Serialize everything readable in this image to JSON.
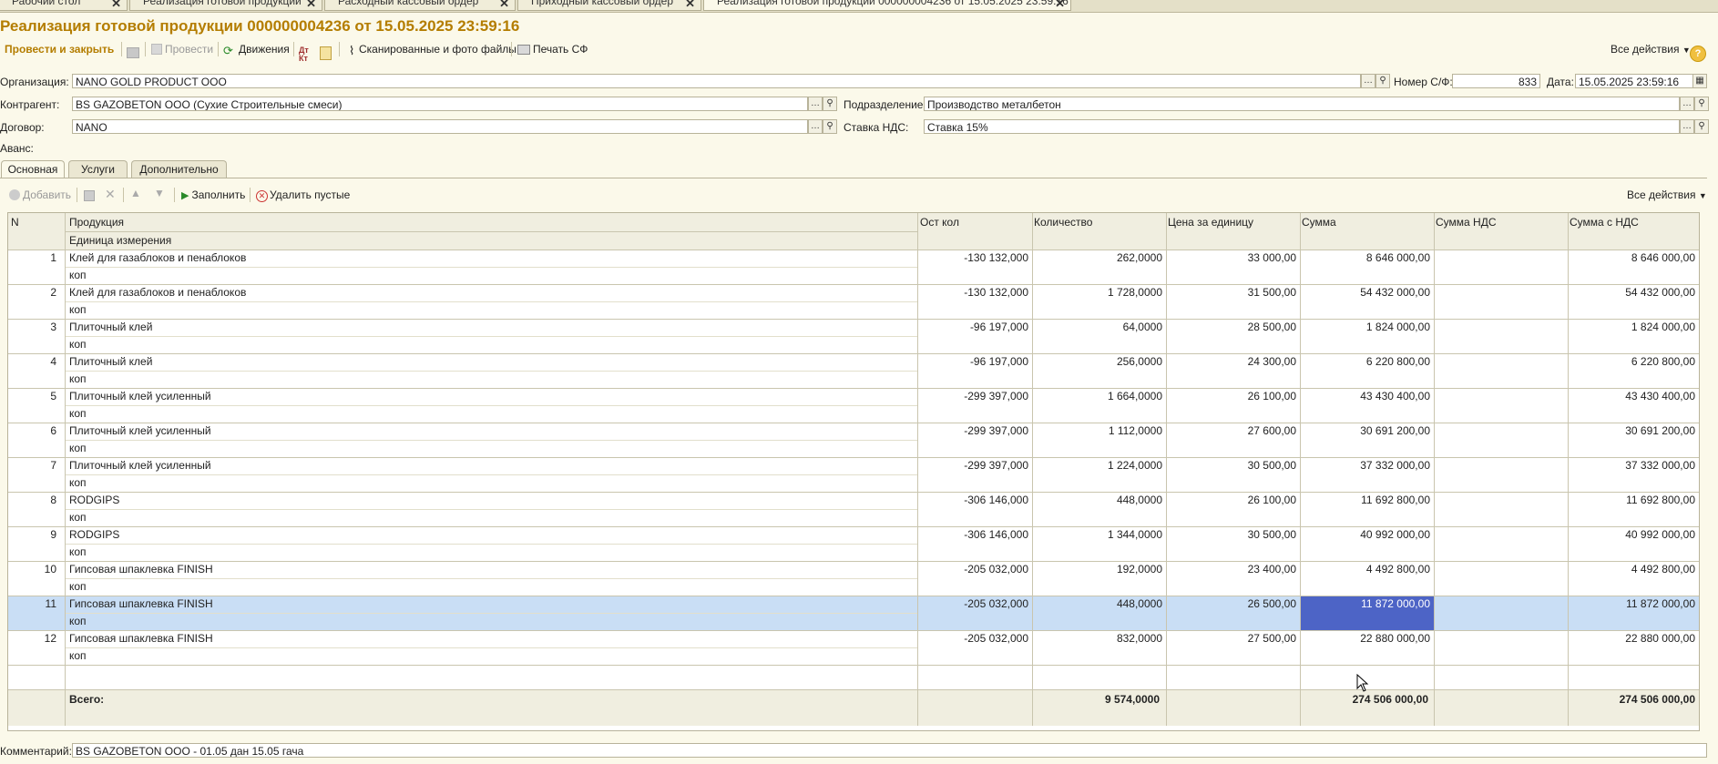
{
  "window_tabs": [
    {
      "label": "Рабочий стол",
      "active": false
    },
    {
      "label": "Реализация готовой продукции",
      "active": false
    },
    {
      "label": "Расходный кассовый ордер",
      "active": false
    },
    {
      "label": "Приходный кассовый ордер",
      "active": false
    },
    {
      "label": "Реализация готовой продукции 000000004236 от 15.05.2025 23:59:16",
      "active": true
    }
  ],
  "doc_title": "Реализация готовой продукции 000000004236 от 15.05.2025 23:59:16",
  "toolbar": {
    "post_close": "Провести и закрыть",
    "post": "Провести",
    "movements": "Движения",
    "scanned": "Сканированные и фото файлы",
    "print_sf": "Печать СФ",
    "all_actions": "Все действия",
    "help": "?"
  },
  "form": {
    "org_label": "Организация:",
    "org_value": "NANO GOLD PRODUCT OOO",
    "sf_label": "Номер С/Ф:",
    "sf_value": "833",
    "date_label": "Дата:",
    "date_value": "15.05.2025 23:59:16",
    "contractor_label": "Контрагент:",
    "contractor_value": "BS GAZOBETON OOO (Сухие Строительные смеси)",
    "division_label": "Подразделение:",
    "division_value": "Производство металбетон",
    "contract_label": "Договор:",
    "contract_value": "NANO",
    "vat_label": "Ставка НДС:",
    "vat_value": "Ставка 15%",
    "advance_label": "Аванс:",
    "comment_label": "Комментарий:",
    "comment_value": "BS GAZOBETON OOO - 01.05 дан 15.05 гача"
  },
  "inner_tabs": [
    "Основная",
    "Услуги",
    "Дополнительно"
  ],
  "table_toolbar": {
    "add": "Добавить",
    "fill": "Заполнить",
    "delete_empty": "Удалить пустые",
    "all_actions": "Все действия"
  },
  "table": {
    "headers": {
      "n": "N",
      "product": "Продукция",
      "unit": "Единица измерения",
      "stock": "Ост кол",
      "qty": "Количество",
      "price": "Цена за единицу",
      "sum": "Сумма",
      "vat": "Сумма НДС",
      "total": "Сумма с НДС"
    },
    "rows": [
      {
        "n": "1",
        "product": "Клей для газаблоков и пенаблоков",
        "unit": "коп",
        "stock": "-130 132,000",
        "qty": "262,0000",
        "price": "33 000,00",
        "sum": "8 646 000,00",
        "vat": "",
        "total": "8 646 000,00"
      },
      {
        "n": "2",
        "product": "Клей для газаблоков и пенаблоков",
        "unit": "коп",
        "stock": "-130 132,000",
        "qty": "1 728,0000",
        "price": "31 500,00",
        "sum": "54 432 000,00",
        "vat": "",
        "total": "54 432 000,00"
      },
      {
        "n": "3",
        "product": "Плиточный клей",
        "unit": "коп",
        "stock": "-96 197,000",
        "qty": "64,0000",
        "price": "28 500,00",
        "sum": "1 824 000,00",
        "vat": "",
        "total": "1 824 000,00"
      },
      {
        "n": "4",
        "product": "Плиточный клей",
        "unit": "коп",
        "stock": "-96 197,000",
        "qty": "256,0000",
        "price": "24 300,00",
        "sum": "6 220 800,00",
        "vat": "",
        "total": "6 220 800,00"
      },
      {
        "n": "5",
        "product": "Плиточный клей усиленный",
        "unit": "коп",
        "stock": "-299 397,000",
        "qty": "1 664,0000",
        "price": "26 100,00",
        "sum": "43 430 400,00",
        "vat": "",
        "total": "43 430 400,00"
      },
      {
        "n": "6",
        "product": "Плиточный клей усиленный",
        "unit": "коп",
        "stock": "-299 397,000",
        "qty": "1 112,0000",
        "price": "27 600,00",
        "sum": "30 691 200,00",
        "vat": "",
        "total": "30 691 200,00"
      },
      {
        "n": "7",
        "product": "Плиточный клей усиленный",
        "unit": "коп",
        "stock": "-299 397,000",
        "qty": "1 224,0000",
        "price": "30 500,00",
        "sum": "37 332 000,00",
        "vat": "",
        "total": "37 332 000,00"
      },
      {
        "n": "8",
        "product": "RODGIPS",
        "unit": "коп",
        "stock": "-306 146,000",
        "qty": "448,0000",
        "price": "26 100,00",
        "sum": "11 692 800,00",
        "vat": "",
        "total": "11 692 800,00"
      },
      {
        "n": "9",
        "product": "RODGIPS",
        "unit": "коп",
        "stock": "-306 146,000",
        "qty": "1 344,0000",
        "price": "30 500,00",
        "sum": "40 992 000,00",
        "vat": "",
        "total": "40 992 000,00"
      },
      {
        "n": "10",
        "product": "Гипсовая шпаклевка FINISH",
        "unit": "коп",
        "stock": "-205 032,000",
        "qty": "192,0000",
        "price": "23 400,00",
        "sum": "4 492 800,00",
        "vat": "",
        "total": "4 492 800,00"
      },
      {
        "n": "11",
        "product": "Гипсовая шпаклевка FINISH",
        "unit": "коп",
        "stock": "-205 032,000",
        "qty": "448,0000",
        "price": "26 500,00",
        "sum": "11 872 000,00",
        "vat": "",
        "total": "11 872 000,00",
        "selected": true
      },
      {
        "n": "12",
        "product": "Гипсовая шпаклевка FINISH",
        "unit": "коп",
        "stock": "-205 032,000",
        "qty": "832,0000",
        "price": "27 500,00",
        "sum": "22 880 000,00",
        "vat": "",
        "total": "22 880 000,00"
      }
    ],
    "footer": {
      "label": "Всего:",
      "qty": "9 574,0000",
      "sum": "274 506 000,00",
      "total": "274 506 000,00"
    }
  },
  "colors": {
    "accent": "#b47d00",
    "background": "#fbf9ea",
    "selection_row": "#c9def5",
    "selection_cell": "#4d64c6"
  }
}
